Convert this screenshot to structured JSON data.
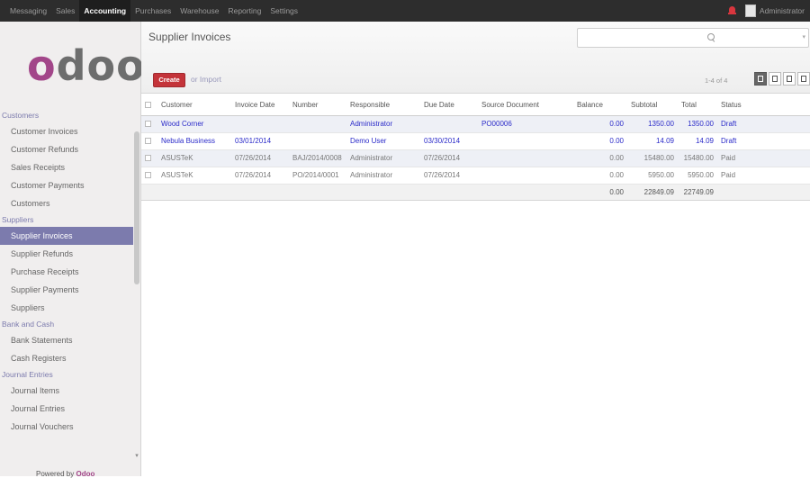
{
  "topbar": {
    "menu": [
      "Messaging",
      "Sales",
      "Accounting",
      "Purchases",
      "Warehouse",
      "Reporting",
      "Settings"
    ],
    "active_index": 2,
    "user": "Administrator"
  },
  "sidebar": {
    "logo": "odoo",
    "sections": [
      {
        "title": "Customers",
        "items": [
          "Customer Invoices",
          "Customer Refunds",
          "Sales Receipts",
          "Customer Payments",
          "Customers"
        ]
      },
      {
        "title": "Suppliers",
        "items": [
          "Supplier Invoices",
          "Supplier Refunds",
          "Purchase Receipts",
          "Supplier Payments",
          "Suppliers"
        ]
      },
      {
        "title": "Bank and Cash",
        "items": [
          "Bank Statements",
          "Cash Registers"
        ]
      },
      {
        "title": "Journal Entries",
        "items": [
          "Journal Items",
          "Journal Entries",
          "Journal Vouchers"
        ]
      }
    ],
    "active_item": "Supplier Invoices",
    "powered_prefix": "Powered by",
    "powered_brand": "Odoo"
  },
  "main": {
    "title": "Supplier Invoices",
    "search_placeholder": "",
    "create_label": "Create",
    "import_label": "or Import",
    "pager": "1-4 of 4"
  },
  "table": {
    "columns": [
      "Customer",
      "Invoice Date",
      "Number",
      "Responsible",
      "Due Date",
      "Source Document",
      "Balance",
      "Subtotal",
      "Total",
      "Status"
    ],
    "rows": [
      {
        "customer": "Wood Corner",
        "invoice_date": "",
        "number": "",
        "responsible": "Administrator",
        "due_date": "",
        "source": "PO00006",
        "balance": "0.00",
        "subtotal": "1350.00",
        "total": "1350.00",
        "status": "Draft",
        "style": "draft"
      },
      {
        "customer": "Nebula Business",
        "invoice_date": "03/01/2014",
        "number": "",
        "responsible": "Demo User",
        "due_date": "03/30/2014",
        "source": "",
        "balance": "0.00",
        "subtotal": "14.09",
        "total": "14.09",
        "status": "Draft",
        "style": "draft"
      },
      {
        "customer": "ASUSTeK",
        "invoice_date": "07/26/2014",
        "number": "BAJ/2014/0008",
        "responsible": "Administrator",
        "due_date": "07/26/2014",
        "source": "",
        "balance": "0.00",
        "subtotal": "15480.00",
        "total": "15480.00",
        "status": "Paid",
        "style": "paid"
      },
      {
        "customer": "ASUSTeK",
        "invoice_date": "07/26/2014",
        "number": "PO/2014/0001",
        "responsible": "Administrator",
        "due_date": "07/26/2014",
        "source": "",
        "balance": "0.00",
        "subtotal": "5950.00",
        "total": "5950.00",
        "status": "Paid",
        "style": "paid"
      }
    ],
    "totals": {
      "balance": "0.00",
      "subtotal": "22849.09",
      "total": "22749.09"
    }
  }
}
